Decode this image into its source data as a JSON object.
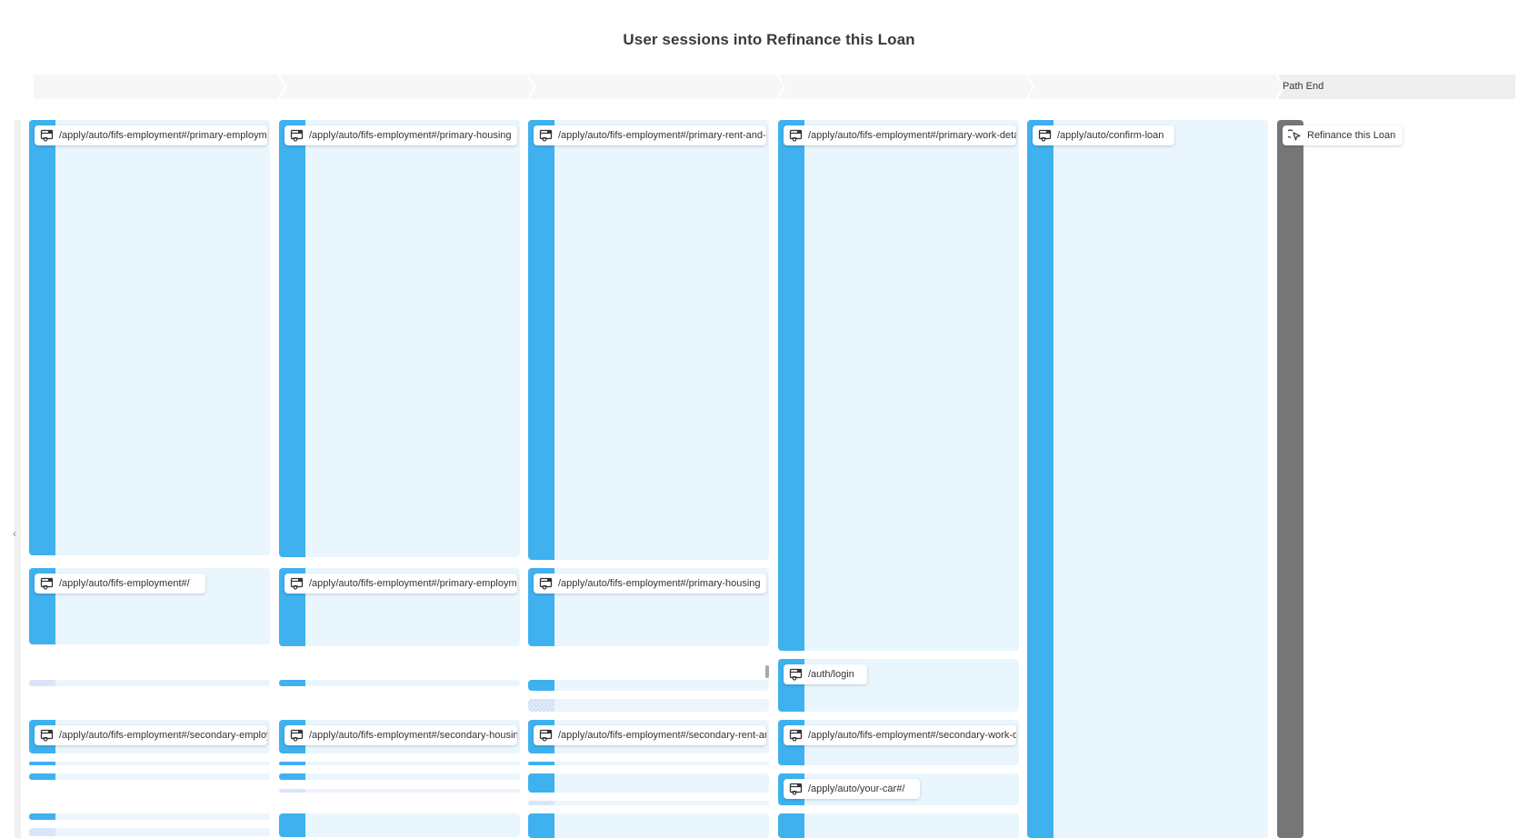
{
  "title": "User sessions into Refinance this Loan",
  "steps": [
    {
      "label": ""
    },
    {
      "label": ""
    },
    {
      "label": ""
    },
    {
      "label": ""
    },
    {
      "label": ""
    },
    {
      "label": "Path End"
    }
  ],
  "colors": {
    "pageview_bar": "#3fb1ef",
    "node_bg": "#eaf6fd",
    "end_bar": "#767676",
    "header_bg": "#f7f7f7",
    "path_end_bg": "#efefef"
  },
  "columns": [
    {
      "nodes": [
        {
          "label": "/apply/auto/fifs-employment#/primary-employment",
          "icon": "pageview-icon",
          "kind": "page"
        },
        {
          "label": "/apply/auto/fifs-employment#/",
          "icon": "pageview-icon",
          "kind": "page"
        },
        {
          "label": "",
          "kind": "other"
        },
        {
          "label": "/apply/auto/fifs-employment#/secondary-employment",
          "icon": "pageview-icon",
          "kind": "page"
        },
        {
          "label": "",
          "kind": "page"
        },
        {
          "label": "",
          "kind": "page"
        },
        {
          "label": "",
          "kind": "page"
        },
        {
          "label": "",
          "kind": "other"
        }
      ]
    },
    {
      "nodes": [
        {
          "label": "/apply/auto/fifs-employment#/primary-housing",
          "icon": "pageview-icon",
          "kind": "page"
        },
        {
          "label": "/apply/auto/fifs-employment#/primary-employment",
          "icon": "pageview-icon",
          "kind": "page"
        },
        {
          "label": "",
          "kind": "page"
        },
        {
          "label": "/apply/auto/fifs-employment#/secondary-housing",
          "icon": "pageview-icon",
          "kind": "page"
        },
        {
          "label": "",
          "kind": "page"
        },
        {
          "label": "",
          "kind": "page"
        },
        {
          "label": "",
          "kind": "other"
        },
        {
          "label": "",
          "kind": "page"
        }
      ]
    },
    {
      "nodes": [
        {
          "label": "/apply/auto/fifs-employment#/primary-rent-and-mortgage",
          "icon": "pageview-icon",
          "kind": "page"
        },
        {
          "label": "/apply/auto/fifs-employment#/primary-housing",
          "icon": "pageview-icon",
          "kind": "page"
        },
        {
          "label": "",
          "kind": "page"
        },
        {
          "label": "",
          "kind": "other"
        },
        {
          "label": "/apply/auto/fifs-employment#/secondary-rent-and-mortgage",
          "icon": "pageview-icon",
          "kind": "page"
        },
        {
          "label": "",
          "kind": "page"
        },
        {
          "label": "",
          "kind": "page"
        },
        {
          "label": "",
          "kind": "other"
        },
        {
          "label": "",
          "kind": "page"
        }
      ]
    },
    {
      "nodes": [
        {
          "label": "/apply/auto/fifs-employment#/primary-work-details",
          "icon": "pageview-icon",
          "kind": "page"
        },
        {
          "label": "/auth/login",
          "icon": "pageview-icon",
          "kind": "page"
        },
        {
          "label": "/apply/auto/fifs-employment#/secondary-work-details",
          "icon": "pageview-icon",
          "kind": "page"
        },
        {
          "label": "/apply/auto/your-car#/",
          "icon": "pageview-icon",
          "kind": "page"
        },
        {
          "label": "",
          "kind": "page"
        }
      ]
    },
    {
      "nodes": [
        {
          "label": "/apply/auto/confirm-loan",
          "icon": "pageview-icon",
          "kind": "page"
        }
      ]
    },
    {
      "nodes": [
        {
          "label": "Refinance this Loan",
          "icon": "click-event-icon",
          "kind": "end"
        }
      ]
    }
  ]
}
